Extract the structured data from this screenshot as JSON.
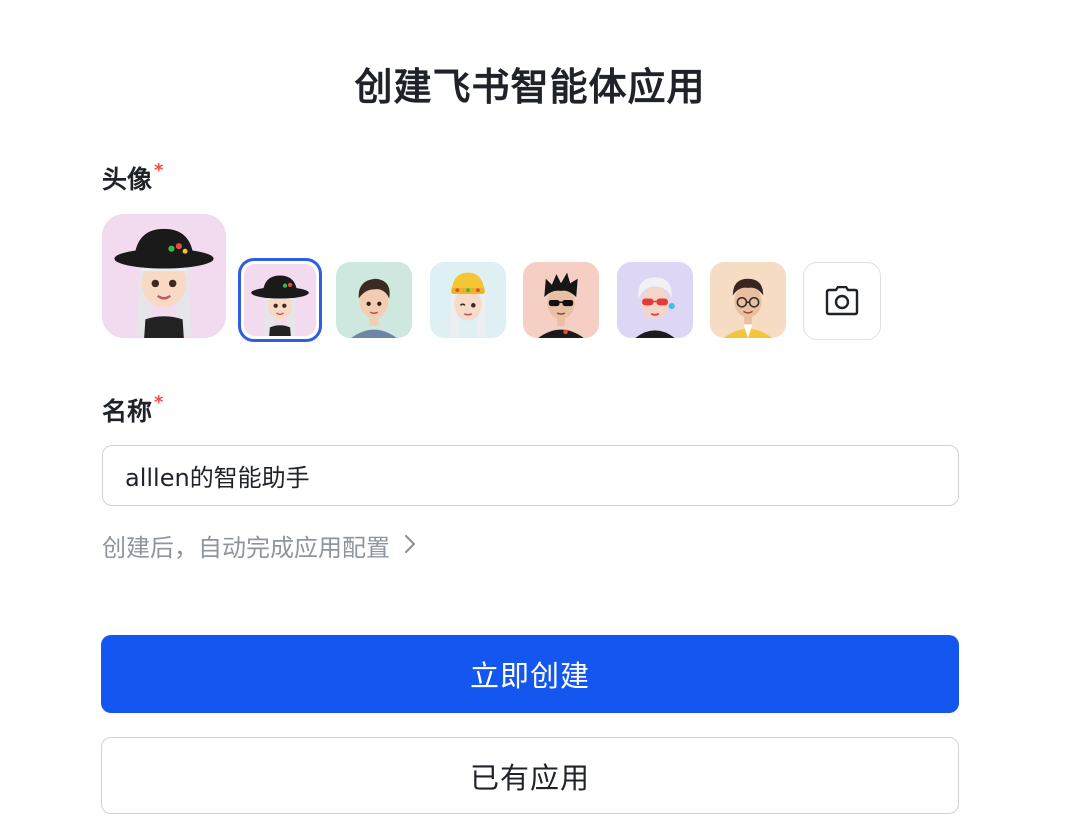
{
  "dialog": {
    "title": "创建飞书智能体应用"
  },
  "avatar_field": {
    "label": "头像",
    "required_mark": "*",
    "options": [
      {
        "name": "avatar-girl-black-hat",
        "bg": "#f3dbef",
        "selected": true
      },
      {
        "name": "avatar-boy-brown-hair",
        "bg": "#cfe8df",
        "selected": false
      },
      {
        "name": "avatar-girl-yellow-hat",
        "bg": "#dff0f4",
        "selected": false
      },
      {
        "name": "avatar-boy-sunglasses",
        "bg": "#f6cfc4",
        "selected": false
      },
      {
        "name": "avatar-girl-red-glasses",
        "bg": "#ddd7f5",
        "selected": false
      },
      {
        "name": "avatar-boy-glasses-yellow-jacket",
        "bg": "#f7dcc4",
        "selected": false
      }
    ],
    "upload_icon": "camera-icon"
  },
  "name_field": {
    "label": "名称",
    "required_mark": "*",
    "value": "alllen的智能助手",
    "placeholder": ""
  },
  "hint": {
    "text": "创建后，自动完成应用配置",
    "icon": "chevron-right-icon"
  },
  "buttons": {
    "create_now": "立即创建",
    "existing_app": "已有应用"
  },
  "colors": {
    "primary": "#1456f0",
    "selected_border": "#2f5fe0",
    "required": "#f54a45",
    "hint_text": "#8f959e"
  }
}
